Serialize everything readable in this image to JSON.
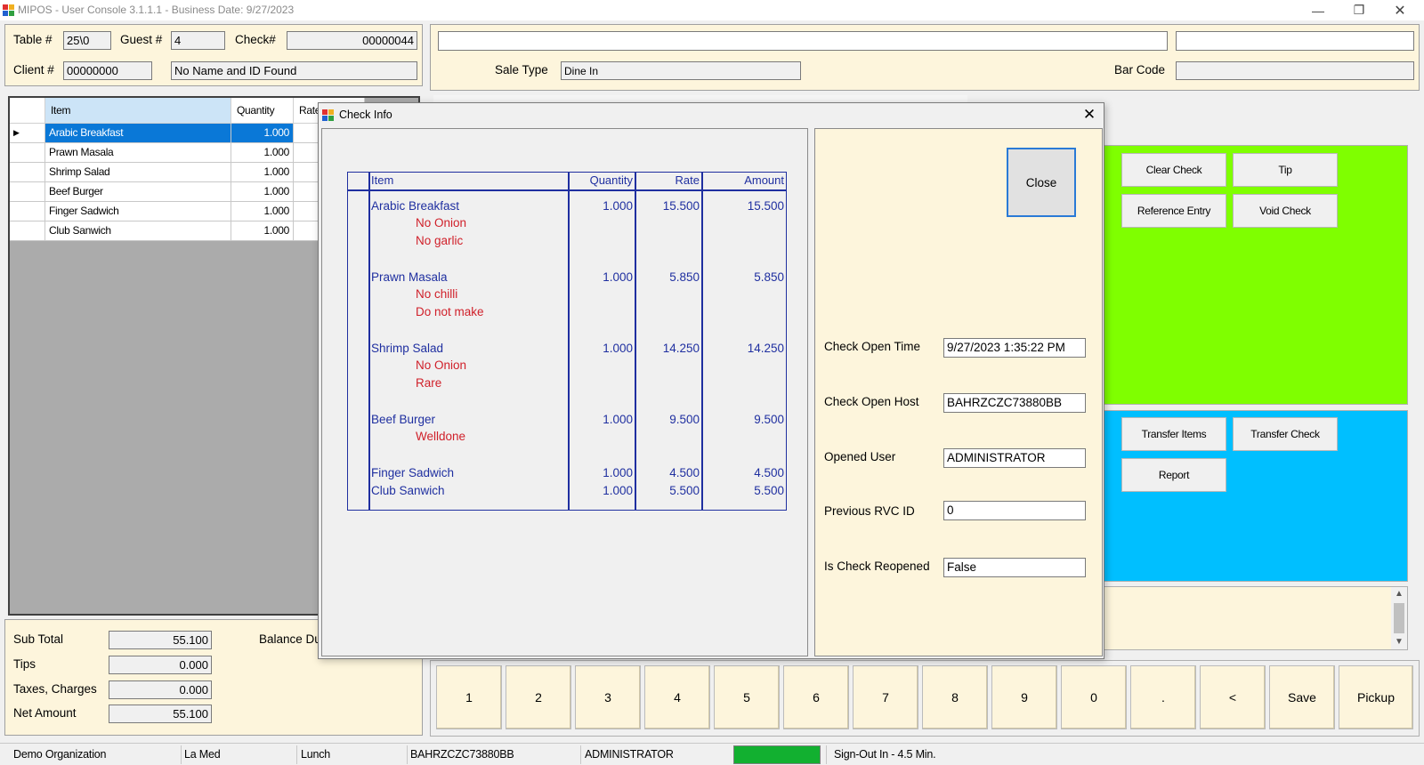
{
  "window": {
    "title": "MIPOS - User Console 3.1.1.1 - Business Date: 9/27/2023"
  },
  "header": {
    "table_label": "Table #",
    "table_value": "25\\0",
    "guest_label": "Guest #",
    "guest_value": "4",
    "check_label": "Check#",
    "check_value": "00000044",
    "client_label": "Client #",
    "client_value": "00000000",
    "client_name": "No Name and ID Found",
    "sale_type_label": "Sale Type",
    "sale_type_value": "Dine In",
    "barcode_label": "Bar Code"
  },
  "grid": {
    "columns": [
      "Item",
      "Quantity",
      "Rate"
    ],
    "rows": [
      {
        "item": "Arabic Breakfast",
        "qty": "1.000"
      },
      {
        "item": "Prawn Masala",
        "qty": "1.000"
      },
      {
        "item": "Shrimp Salad",
        "qty": "1.000"
      },
      {
        "item": "Beef Burger",
        "qty": "1.000"
      },
      {
        "item": "Finger Sadwich",
        "qty": "1.000"
      },
      {
        "item": "Club Sanwich",
        "qty": "1.000"
      }
    ]
  },
  "totals": {
    "subtotal_label": "Sub Total",
    "subtotal": "55.100",
    "tips_label": "Tips",
    "tips": "0.000",
    "taxes_label": "Taxes, Charges",
    "taxes": "0.000",
    "net_label": "Net Amount",
    "net": "55.100",
    "balance_label": "Balance Du"
  },
  "function_buttons": {
    "green": [
      "Clear Check",
      "Tip",
      "Reference Entry",
      "Void Check"
    ],
    "blue": [
      "Transfer Items",
      "Transfer Check",
      "Report"
    ]
  },
  "keypad": [
    "1",
    "2",
    "3",
    "4",
    "5",
    "6",
    "7",
    "8",
    "9",
    "0",
    ".",
    "<",
    "Save",
    "Pickup"
  ],
  "status": {
    "organization": "Demo Organization",
    "rvc": "La Med",
    "period": "Lunch",
    "host": "BAHRZCZC73880BB",
    "user": "ADMINISTRATOR",
    "signout": "Sign-Out In - 4.5 Min."
  },
  "modal": {
    "title": "Check Info",
    "close_label": "Close",
    "table_headers": {
      "item": "Item",
      "quantity": "Quantity",
      "rate": "Rate",
      "amount": "Amount"
    },
    "items": [
      {
        "name": "Arabic Breakfast",
        "qty": "1.000",
        "rate": "15.500",
        "amount": "15.500",
        "mods": [
          "No Onion",
          "No garlic"
        ]
      },
      {
        "name": "Prawn Masala",
        "qty": "1.000",
        "rate": "5.850",
        "amount": "5.850",
        "mods": [
          "No chilli",
          "Do not make"
        ]
      },
      {
        "name": "Shrimp Salad",
        "qty": "1.000",
        "rate": "14.250",
        "amount": "14.250",
        "mods": [
          "No Onion",
          "Rare"
        ]
      },
      {
        "name": "Beef Burger",
        "qty": "1.000",
        "rate": "9.500",
        "amount": "9.500",
        "mods": [
          "Welldone"
        ]
      },
      {
        "name": "Finger Sadwich",
        "qty": "1.000",
        "rate": "4.500",
        "amount": "4.500",
        "mods": []
      },
      {
        "name": "Club Sanwich",
        "qty": "1.000",
        "rate": "5.500",
        "amount": "5.500",
        "mods": []
      }
    ],
    "info": {
      "open_time_label": "Check Open Time",
      "open_time": "9/27/2023 1:35:22 PM",
      "open_host_label": "Check Open Host",
      "open_host": "BAHRZCZC73880BB",
      "opened_user_label": "Opened User",
      "opened_user": "ADMINISTRATOR",
      "prev_rvc_label": "Previous RVC ID",
      "prev_rvc": "0",
      "reopened_label": "Is Check Reopened",
      "reopened": "False"
    }
  },
  "colors": {
    "cream": "#fdf5dc",
    "green_panel": "#7fff00",
    "blue_panel": "#00bfff",
    "selection": "#0a78d7",
    "status_green": "#12b030",
    "modal_blue": "#1f2fa0",
    "modifier_red": "#d0202a"
  }
}
